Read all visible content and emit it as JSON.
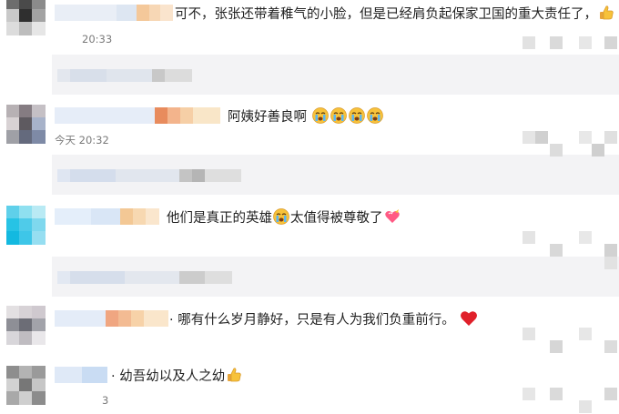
{
  "comments": [
    {
      "text": "可不，张张还带着稚气的小脸，但是已经肩负起保家卫国的重大责任了，",
      "emoji": "thumbs-up-icon",
      "time": "20:33"
    },
    {
      "text": "阿姨好善良啊",
      "emoji": "crying-face-icon x4",
      "time": "今天 20:32"
    },
    {
      "text_a": "他们是真正的英雄",
      "text_b": "太值得被尊敬了",
      "emoji_a": "crying-face-icon",
      "emoji_b": "heart-ribbon-icon"
    },
    {
      "text": "哪有什么岁月静好，只是有人为我们负重前行。",
      "emoji": "red-heart-icon"
    },
    {
      "text": "幼吾幼以及人之幼",
      "emoji": "thumbs-up-icon",
      "time": "3"
    }
  ],
  "colors": {
    "reply_bg": "#f3f3f5",
    "heart": "#e0202a",
    "yellow": "#f7c23a"
  }
}
